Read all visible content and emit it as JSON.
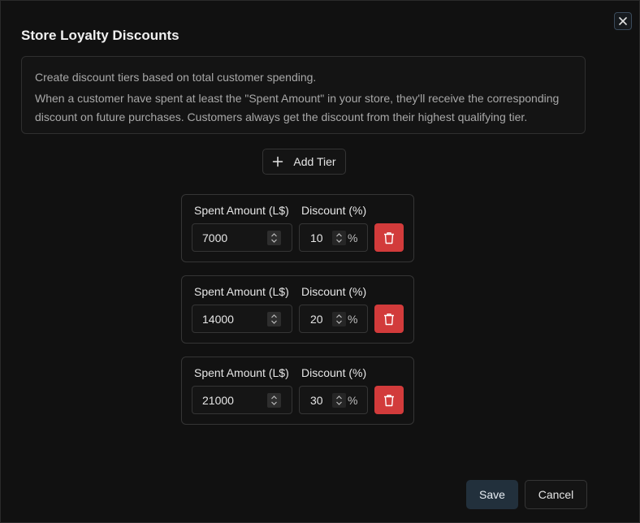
{
  "dialog": {
    "title": "Store Loyalty Discounts",
    "description_line1": "Create discount tiers based on total customer spending.",
    "description_line2": "When a customer have spent at least the \"Spent Amount\" in your store, they'll receive the corresponding discount on future purchases. Customers always get the discount from their highest qualifying tier."
  },
  "toolbar": {
    "add_tier_label": "Add Tier"
  },
  "tiers": [
    {
      "spent_label": "Spent Amount (L$)",
      "discount_label": "Discount (%)",
      "spent_value": "7000",
      "discount_value": "10",
      "percent_suffix": "%"
    },
    {
      "spent_label": "Spent Amount (L$)",
      "discount_label": "Discount (%)",
      "spent_value": "14000",
      "discount_value": "20",
      "percent_suffix": "%"
    },
    {
      "spent_label": "Spent Amount (L$)",
      "discount_label": "Discount (%)",
      "spent_value": "21000",
      "discount_value": "30",
      "percent_suffix": "%"
    }
  ],
  "footer": {
    "save_label": "Save",
    "cancel_label": "Cancel"
  },
  "icons": {
    "close": "close-icon",
    "add": "plus-icon",
    "delete": "trash-icon",
    "stepper": "chevron-up-down-icon"
  },
  "colors": {
    "background": "#111111",
    "delete_button": "#d23b3b",
    "save_button": "#22303c"
  }
}
